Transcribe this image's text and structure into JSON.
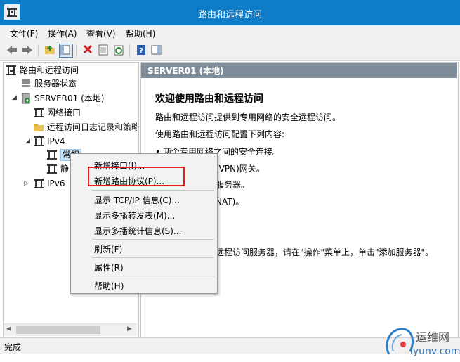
{
  "window": {
    "title": "路由和远程访问",
    "icon": "rras-app-icon"
  },
  "menubar": [
    {
      "label": "文件(F)"
    },
    {
      "label": "操作(A)"
    },
    {
      "label": "查看(V)"
    },
    {
      "label": "帮助(H)"
    }
  ],
  "toolbar": {
    "icons": [
      "back-arrow-icon",
      "forward-arrow-icon",
      "up-folder-icon",
      "show-tree-icon",
      "delete-icon",
      "properties-icon",
      "refresh-icon",
      "help-icon",
      "show-pane-icon"
    ]
  },
  "tree": {
    "items": [
      {
        "label": "路由和远程访问",
        "icon": "rras-icon"
      },
      {
        "label": "服务器状态",
        "icon": "server-status-icon"
      },
      {
        "label": "SERVER01 (本地)",
        "icon": "server-icon",
        "expander": "expanded"
      },
      {
        "label": "网络接口",
        "icon": "network-interface-icon"
      },
      {
        "label": "远程访问日志记录和策略",
        "icon": "folder-icon"
      },
      {
        "label": "IPv4",
        "icon": "ipv4-icon",
        "expander": "expanded"
      },
      {
        "label": "常规",
        "icon": "general-icon",
        "selected": true
      },
      {
        "label": "静",
        "icon": "static-routes-icon"
      },
      {
        "label": "IPv6",
        "icon": "ipv6-icon",
        "expander": "collapsed"
      }
    ]
  },
  "right_pane": {
    "header": "SERVER01 (本地)",
    "heading": "欢迎使用路由和远程访问",
    "intro": "路由和远程访问提供到专用网络的安全远程访问。",
    "config_label": "使用路由和远程访问配置下列内容:",
    "bullet1": "• 两个专用网络之间的安全连接。",
    "partial_vpn": "(VPN)网关。",
    "partial_server": "服务器。",
    "partial_nat": "NAT)。",
    "partial_add_server": "远程访问服务器，请在\"操作\"菜单上，单击\"添加服务器\"。"
  },
  "context_menu": {
    "items": [
      {
        "label": "新增接口(I)..."
      },
      {
        "label": "新增路由协议(P)...",
        "highlighted_by_red_box": true
      },
      {
        "label": "显示 TCP/IP 信息(C)..."
      },
      {
        "label": "显示多播转发表(M)..."
      },
      {
        "label": "显示多播统计信息(S)..."
      },
      {
        "label": "刷新(F)"
      },
      {
        "label": "属性(R)"
      },
      {
        "label": "帮助(H)"
      }
    ]
  },
  "status": {
    "text": "完成"
  },
  "watermark": {
    "text1": "运维网",
    "text2": "iyunv.com"
  },
  "colors": {
    "titlebar": "#0f7cc7",
    "header": "#7f8c99",
    "highlight_box": "#e02020"
  }
}
